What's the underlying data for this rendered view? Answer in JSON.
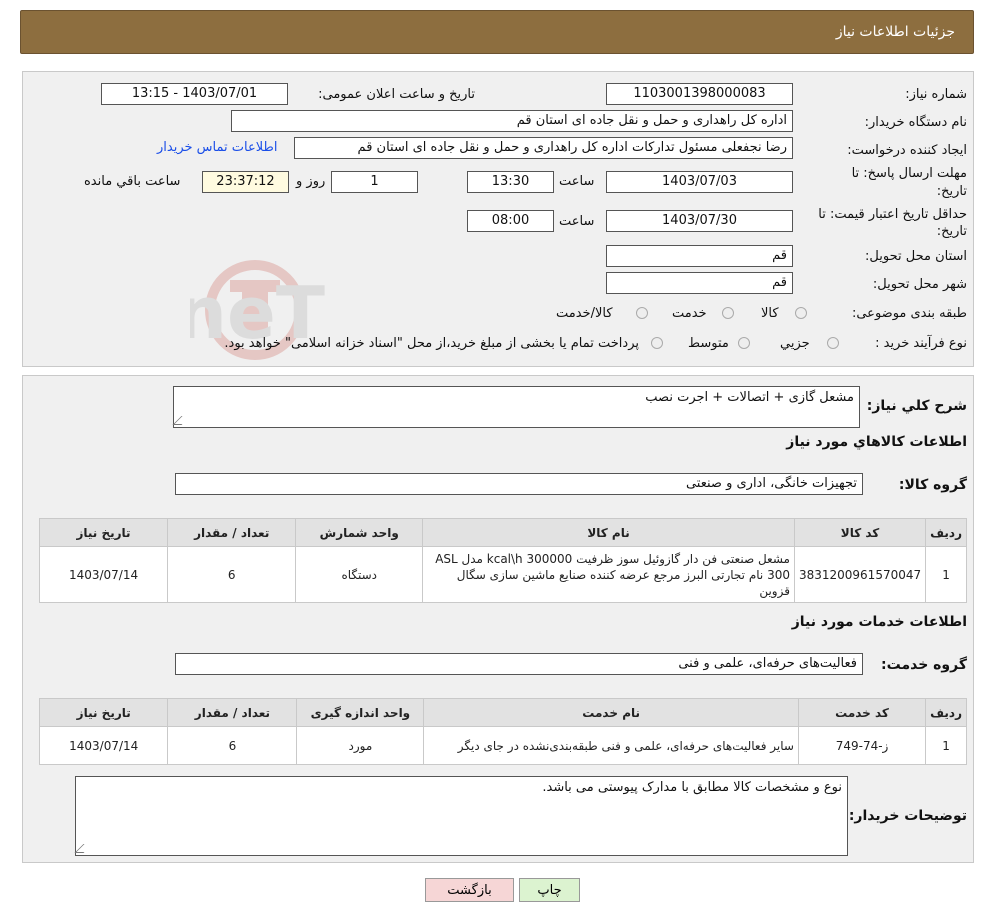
{
  "header": {
    "title": "جزئیات اطلاعات نیاز"
  },
  "fields": {
    "need_number_label": "شماره نیاز:",
    "need_number": "1103001398000083",
    "announce_label": "تاریخ و ساعت اعلان عمومی:",
    "announce_value": "1403/07/01 - 13:15",
    "buyer_label": "نام دستگاه خریدار:",
    "buyer_value": "اداره کل راهداری و حمل و نقل جاده ای استان قم",
    "creator_label": "ایجاد کننده درخواست:",
    "creator_value": "رضا  نجفعلی مسئول تدارکات اداره کل راهداری و حمل و نقل جاده ای استان قم",
    "contact_link": "اطلاعات تماس خریدار",
    "deadline_label_1": "مهلت ارسال پاسخ: تا",
    "deadline_label_2": "تاریخ:",
    "deadline_date": "1403/07/03",
    "time_label": "ساعت",
    "deadline_time": "13:30",
    "days_value": "1",
    "days_label": "روز و",
    "remaining_time": "23:37:12",
    "remaining_label": "ساعت باقي مانده",
    "validity_label_1": "حداقل تاریخ اعتبار قیمت: تا",
    "validity_label_2": "تاریخ:",
    "validity_date": "1403/07/30",
    "validity_time": "08:00",
    "province_label": "استان محل تحویل:",
    "province_value": "قم",
    "city_label": "شهر محل تحویل:",
    "city_value": "قم",
    "category_label": "طبقه بندی موضوعی:",
    "category_options": [
      "کالا",
      "خدمت",
      "کالا/خدمت"
    ],
    "purchase_type_label": "نوع فرآیند خرید :",
    "purchase_options": [
      "جزيي",
      "متوسط"
    ],
    "purchase_note": "پرداخت تمام یا بخشی از مبلغ خرید،از محل \"اسناد خزانه اسلامی\" خواهد بود."
  },
  "watermark": "AriaTender.neT",
  "details": {
    "summary_label": "شرح كلي نياز:",
    "summary_value": "مشعل گازی + اتصالات + اجرت نصب",
    "goods_section": "اطلاعات كالاهاي مورد نياز",
    "goods_group_label": "گروه كالا:",
    "goods_group_value": "تجهیزات خانگی، اداری و صنعتی",
    "goods_headers": [
      "رديف",
      "كد كالا",
      "نام كالا",
      "واحد شمارش",
      "تعداد / مقدار",
      "تاريخ نياز"
    ],
    "goods_rows": [
      [
        "1",
        "3831200961570047",
        "مشعل صنعتی فن دار گازوئیل سوز ظرفیت 300000 kcal\\h مدل ASL 300 نام تجارتی البرز مرجع عرضه کننده صنایع ماشین سازی سگال قزوین",
        "دستگاه",
        "6",
        "1403/07/14"
      ]
    ],
    "services_section": "اطلاعات خدمات مورد نياز",
    "service_group_label": "گروه خدمت:",
    "service_group_value": "فعالیت‌های حرفه‌ای، علمی و فنی",
    "service_headers": [
      "رديف",
      "كد خدمت",
      "نام خدمت",
      "واحد اندازه گيری",
      "تعداد / مقدار",
      "تاريخ نياز"
    ],
    "service_rows": [
      [
        "1",
        "ز-74-749",
        "سایر فعالیت‌های حرفه‌ای، علمی و فنی طبقه‌بندی‌نشده در جای دیگر",
        "مورد",
        "6",
        "1403/07/14"
      ]
    ],
    "buyer_notes_label": "توضیحات خریدار:",
    "buyer_notes_value": "نوع و مشخصات کالا مطابق با مدارک پیوستی می باشد."
  },
  "buttons": {
    "print": "چاپ",
    "back": "بازگشت"
  }
}
